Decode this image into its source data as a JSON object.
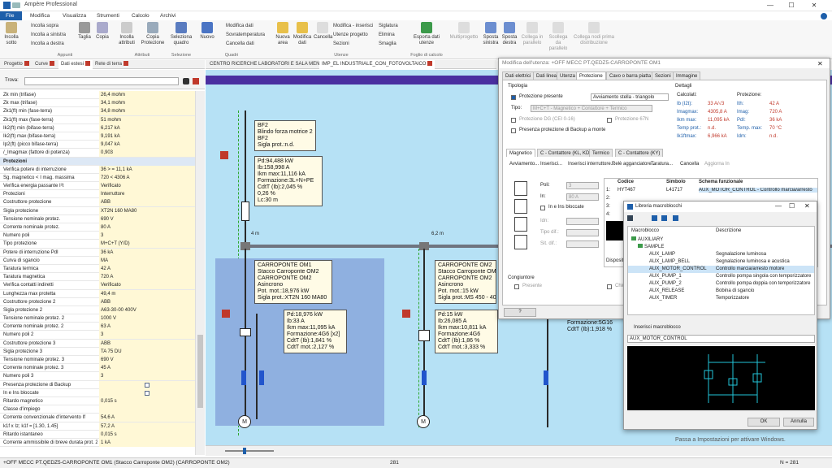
{
  "app": {
    "title": "Ampère Professional"
  },
  "ribbon_tabs": [
    "File",
    "Modifica",
    "Visualizza",
    "Strumenti",
    "Calcolo",
    "Archivi"
  ],
  "ribbon": {
    "incolla_sotto": "Incolla sotto",
    "incolla_sopra": "Incolla sopra",
    "incolla_sinistra": "Incolla a sinistra",
    "incolla_destra": "Incolla a destra",
    "taglia": "Taglia",
    "copia": "Copia",
    "incolla_attributi": "Incolla attributi",
    "copia_protezione": "Copia Protezione",
    "seleziona_quadro": "Seleziona quadro",
    "nuovo": "Nuovo",
    "modifica_dati": "Modifica dati",
    "sovratemperatura": "Sovratemperatura",
    "cancella_dati": "Cancella dati",
    "nuova_area": "Nuova area",
    "modifica_dati2": "Modifica dati",
    "cancella": "Cancella",
    "modifica_inserisci": "Modifica - inserisci",
    "utenze_progetto": "Utenze progetto",
    "sezioni": "Sezioni",
    "siglatura": "Siglatura",
    "elimina": "Elimina",
    "smaglia": "Smaglia",
    "esporta_dati": "Esporta dati utenze",
    "multiprogetto": "Multiprogetto",
    "sposta_sinistra": "Sposta sinistra",
    "sposta_destra": "Sposta destra",
    "collega_parallelo": "Collega in parallelo",
    "scollega_parallelo": "Scollega da parallelo",
    "collega_nodi": "Collega nodi prima distribuzione",
    "groups": {
      "appunti": "Appunti",
      "attributi": "Attributi",
      "selezione": "Selezione",
      "quadri": "Quadri",
      "utenze": "Utenze",
      "foglio": "Foglio di calcolo"
    }
  },
  "panel_tabs": [
    "Progetto",
    "Curve",
    "Dati estesi",
    "Rete di terra"
  ],
  "search_label": "Trova:",
  "properties": [
    [
      "Zk min (trifase)",
      "26,4 mohm"
    ],
    [
      "Zk max (trifase)",
      "34,1 mohm"
    ],
    [
      "Zk1(ft) min (fase-terra)",
      "34,8 mohm"
    ],
    [
      "Zk1(ft) max (fase-terra)",
      "51 mohm"
    ],
    [
      "Ik2(ft) min (bifase-terra)",
      "6,217 kA"
    ],
    [
      "Ik2(ft) max (bifase-terra)",
      "9,191 kA"
    ],
    [
      "Ip2(ft) (picco bifase-terra)",
      "9,047 kA"
    ],
    [
      "/_Imagmax (fattore di potenza)",
      "0,903"
    ],
    [
      "Protezioni",
      ""
    ],
    [
      "Verifica potere di interruzione",
      "36 > = 11,1 kA"
    ],
    [
      "Sg. magnetico < I mag. massima",
      "720 < 4306 A"
    ],
    [
      "Verifica energia passante I²t",
      "Verificato"
    ],
    [
      "Protezioni",
      "Interruttore"
    ],
    [
      "Costruttore protezione",
      "ABB"
    ],
    [
      "Sigla protezione",
      "XT2N 160 MA80"
    ],
    [
      "Tensione nominale protez.",
      "690 V"
    ],
    [
      "Corrente nominale protez.",
      "80 A"
    ],
    [
      "Numero poli",
      "3"
    ],
    [
      "Tipo protezione",
      "M+C+T (Y/D)"
    ],
    [
      "Potere di interruzione PdI",
      "36 kA"
    ],
    [
      "Curva di sgancio",
      "MA"
    ],
    [
      "Taratura termica",
      "42 A"
    ],
    [
      "Taratura magnetica",
      "720 A"
    ],
    [
      "Verifica contatti indiretti",
      "Verificato"
    ],
    [
      "Lunghezza max protetta",
      "49,4 m"
    ],
    [
      "Costruttore protezione 2",
      "ABB"
    ],
    [
      "Sigla protezione 2",
      "A63-30-00 400V"
    ],
    [
      "Tensione nominale protez. 2",
      "1000 V"
    ],
    [
      "Corrente nominale protez. 2",
      "63 A"
    ],
    [
      "Numero poli 2",
      "3"
    ],
    [
      "Costruttore protezione 3",
      "ABB"
    ],
    [
      "Sigla protezione 3",
      "TA 75 DU"
    ],
    [
      "Tensione nominale protez. 3",
      "690 V"
    ],
    [
      "Corrente nominale protez. 3",
      "45 A"
    ],
    [
      "Numero poli 3",
      "3"
    ],
    [
      "Presenza protezione di Backup",
      ""
    ],
    [
      "In e Ins bloccate",
      ""
    ],
    [
      "Ritardo magnetico",
      "0,015 s"
    ],
    [
      "Classe d'impiego",
      ""
    ],
    [
      "Corrente convenzionale d'intervento If",
      "54,6 A"
    ],
    [
      "k1f x Iz; k1f = [1.30, 1.45]",
      "57,2 A"
    ],
    [
      "Ritardo istantaneo",
      "0,015 s"
    ],
    [
      "Corrente ammissibile di breve durata prot. 2",
      "1 kA"
    ]
  ],
  "cad_tabs": [
    "CENTRO RICERCHE LABORATORI E SALA MENSA",
    "IMP_EL INDUSTRIALE_CON_FOTOVOLTAICO"
  ],
  "cad": {
    "bf2_lines": [
      "BF2",
      "Blindo forza motrice 2",
      "BF2",
      "Sigla prot.:n.d."
    ],
    "bf2_calc": [
      "Pd:94,488 kW",
      "Ib:158,998 A",
      "Ikm max:11,116 kA",
      "Formazione:3L+N+PE",
      "CdtT (Ib):2,045 %",
      "0,26 %",
      "Lc:30 m"
    ],
    "len1": "4 m",
    "len2": "6,2 m",
    "om1_lines": [
      "CARROPONTE OM1",
      "Stacco Carroponte OM2",
      "CARROPONTE OM2",
      "Asincrono",
      "Pot. mot.:18,976 kW",
      "Sigla prot.:XT2N 160 MA80"
    ],
    "om1_calc": [
      "Pd:18,976 kW",
      "Ib:33 A",
      "Ikm max:11,095 kA",
      "Formazione:4G6 [x2]",
      "CdtT (Ib):1,841 %",
      "CdtT mot.:2,127 %"
    ],
    "om2_lines": [
      "CARROPONTE OM2",
      "Stacco Carroponte OM2",
      "CARROPONTE OM2",
      "Asincrono",
      "Pot. mot.:15 kW",
      "Sigla prot.:MS 450 - 40"
    ],
    "om2_calc": [
      "Pd:15 kW",
      "Ib:26,085 A",
      "Ikm max:10,811 kA",
      "Formazione:4G6",
      "CdtT (Ib):1,86 %",
      "CdtT mot.:3,333 %"
    ],
    "om3_lines": [
      "Formazione:5G16",
      "CdtT (Ib):1,918 %"
    ]
  },
  "dialog": {
    "title": "Modifica dell'utenza: +OFF MECC PT.QEDZ5-CARROPONTE OM1",
    "tabs": [
      "Dati elettrici",
      "Dati linea",
      "Utenza",
      "Protezione",
      "Cavo o barra piatta",
      "Sezioni",
      "Immagine"
    ],
    "tipologia": "Tipologia",
    "protezione_presente": "Protezione presente",
    "avviamento": "Avviamento stella - triangolo",
    "tipo_label": "Tipo:",
    "tipo_value": "M+C+T - Magnetico + Contattore + Termico",
    "prot_dg": "Protezione DG (CEI 0-16)",
    "prot_67n": "Protezione 67N",
    "backup": "Presenza protezione di Backup a monte",
    "dettagli": "Dettagli",
    "calcolati": "Calcolati:",
    "protezione_h": "Protezione:",
    "det_left": [
      [
        "Ib (I2t):",
        "33 A/√3"
      ],
      [
        "Imagmax:",
        "4305,8 A"
      ],
      [
        "Ikm max:",
        "11,095 kA"
      ],
      [
        "Temp prot.:",
        "n.d."
      ],
      [
        "Ik1ftmax:",
        "6,966 kA"
      ]
    ],
    "det_right": [
      [
        "Ith:",
        "42 A"
      ],
      [
        "Imag:",
        "720 A"
      ],
      [
        "PdI:",
        "36 kA"
      ],
      [
        "Temp. max:",
        "70 °C"
      ],
      [
        "Idm:",
        "n.d."
      ]
    ],
    "subtabs": [
      "Magnetico",
      "C - Contattore (KL, KD)",
      "Termico",
      "C - Contattore (KY)"
    ],
    "tools": [
      "Avviamento...",
      "Inserisci...",
      "Inserisci interruttore...",
      "Relè agganciatore...",
      "Taratura...",
      "Cancella",
      "Aggiorna In"
    ],
    "poli_label": "Poli:",
    "poli_value": "3",
    "in_label": "In:",
    "in_value": "80 A",
    "ins_bloccate": "In e Ins bloccate",
    "idn_label": "Idn:",
    "tipo_diff_label": "Tipo dif.:",
    "sit_label": "Sit. dif.:",
    "table_headers": [
      "Codice",
      "Simbolo",
      "Schema funzionale"
    ],
    "table_row": [
      "HYT467",
      "L41717",
      "AUX_MOTOR_CONTROL - Controllo marcia/arresto"
    ],
    "row_nums": [
      "1:",
      "2:",
      "3:",
      "4:"
    ],
    "dispositivi": "Dispositivi",
    "congiuntore": "Congiuntore",
    "presente": "Presente",
    "chiudi": "Chiu",
    "help": "?"
  },
  "library": {
    "title": "Libreria macroblocchi",
    "col_macro": "Macroblocco",
    "col_desc": "Descrizione",
    "auxiliary": "AUXILIARY",
    "sample": "SAMPLE",
    "items": [
      [
        "AUX_LAMP",
        "Segnalazione luminosa"
      ],
      [
        "AUX_LAMP_BELL",
        "Segnalazione luminosa e acustica"
      ],
      [
        "AUX_MOTOR_CONTROL",
        "Controllo marcia/arresto motore"
      ],
      [
        "AUX_PUMP_1",
        "Controllo pompa singola con temporizzatore"
      ],
      [
        "AUX_PUMP_2",
        "Controllo pompa doppia con temporizzatore"
      ],
      [
        "AUX_RELEASE",
        "Bobina di sgancio"
      ],
      [
        "AUX_TIMER",
        "Temporizzatore"
      ]
    ],
    "insert_label": "Inserisci macroblocco",
    "selected": "AUX_MOTOR_CONTROL",
    "ok": "OK",
    "cancel": "Annulla"
  },
  "watermark": "Passa a Impostazioni per attivare Windows.",
  "status": {
    "left": "+OFF MECC PT.QEDZ5-CARROPONTE OM1 (Stacco Carroponte OM2) (CARROPONTE OM2)",
    "mid": "281",
    "right": "N = 281"
  },
  "colors": {
    "accent": "#1e5faa",
    "cad_bg": "#b6e1f5",
    "header_band": "#4a2fa0",
    "highlight_row": "#cce4f7"
  }
}
